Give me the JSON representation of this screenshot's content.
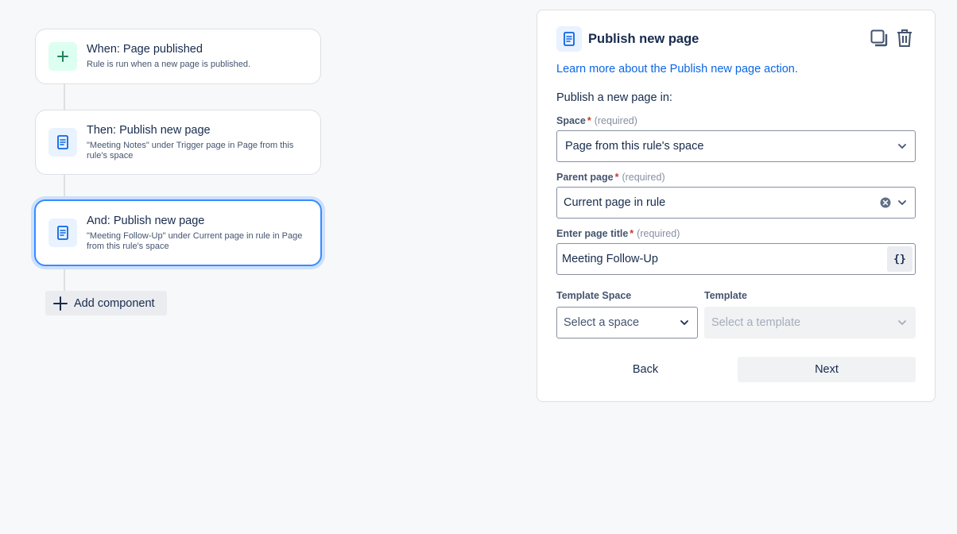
{
  "flow": {
    "trigger": {
      "title": "When: Page published",
      "description": "Rule is run when a new page is published.",
      "icon": "plus-icon"
    },
    "actions": [
      {
        "title": "Then: Publish new page",
        "description": "\"Meeting Notes\" under Trigger page in Page from this rule's space",
        "icon": "page-icon"
      },
      {
        "title": "And: Publish new page",
        "description": "\"Meeting Follow-Up\" under Current page in rule in Page from this rule's space",
        "icon": "page-icon",
        "selected": true
      }
    ],
    "add_component_label": "Add component"
  },
  "panel": {
    "title": "Publish new page",
    "learn_more": "Learn more about the Publish new page action.",
    "intro": "Publish a new page in:",
    "required_text": "(required)",
    "space": {
      "label": "Space",
      "value": "Page from this rule's space"
    },
    "parent_page": {
      "label": "Parent page",
      "value": "Current page in rule"
    },
    "page_title": {
      "label": "Enter page title",
      "value": "Meeting Follow-Up",
      "smart_value_glyph": "{}"
    },
    "template_space": {
      "label": "Template Space",
      "placeholder": "Select a space"
    },
    "template": {
      "label": "Template",
      "placeholder": "Select a template",
      "disabled": true
    },
    "back_label": "Back",
    "next_label": "Next"
  },
  "colors": {
    "background": "#f7f8f9",
    "link": "#0c66e4",
    "selected_border": "#388bff",
    "trigger_icon_bg": "#dcfff1",
    "action_icon_bg": "#e9f2ff",
    "required": "#c9372c"
  }
}
